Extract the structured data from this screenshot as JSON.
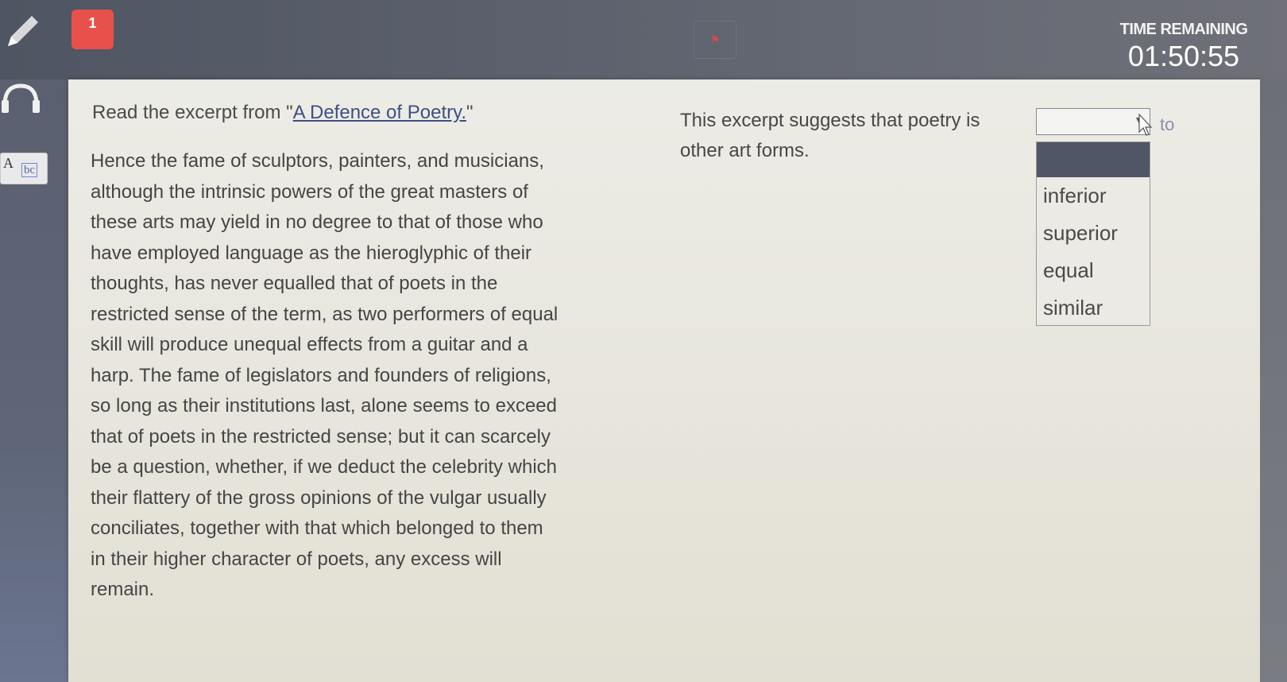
{
  "header": {
    "question_number": "1",
    "timer_label": "TIME REMAINING",
    "timer_value": "01:50:55"
  },
  "toolbar": {
    "tools": [
      {
        "name": "pencil-icon"
      },
      {
        "name": "headphones-icon"
      },
      {
        "name": "abc-dictionary-icon",
        "label_cap": "A",
        "label_low": "bc"
      }
    ]
  },
  "passage": {
    "intro_prefix": "Read the excerpt from \"",
    "intro_link": "A Defence of Poetry.",
    "intro_suffix": "\"",
    "lines": [
      "Hence the fame of sculptors, painters, and musicians,",
      "although the intrinsic powers of the great masters of",
      "these arts may yield in no degree to that of those who",
      "have employed language as the hieroglyphic of their",
      "thoughts, has never equalled that of poets in the",
      "restricted sense of the term, as two performers of equal",
      "skill will produce unequal effects from a guitar and a",
      "harp. The fame of legislators and founders of religions,",
      "so long as their institutions last, alone seems to exceed",
      "that of poets in the restricted sense; but it can scarcely",
      "be a question, whether, if we deduct the celebrity which",
      "their flattery of the gross opinions of the vulgar usually",
      "conciliates, together with that which belonged to them",
      "in their higher character of poets, any excess will",
      "remain."
    ]
  },
  "question": {
    "prefix": "This excerpt suggests that poetry is",
    "suffix": "to",
    "line2": "other art forms.",
    "selected_value": "",
    "options": [
      "inferior",
      "superior",
      "equal",
      "similar"
    ]
  },
  "colors": {
    "question_badge": "#e8514b",
    "link": "#3f4f83",
    "dropdown_highlight": "#505666"
  }
}
